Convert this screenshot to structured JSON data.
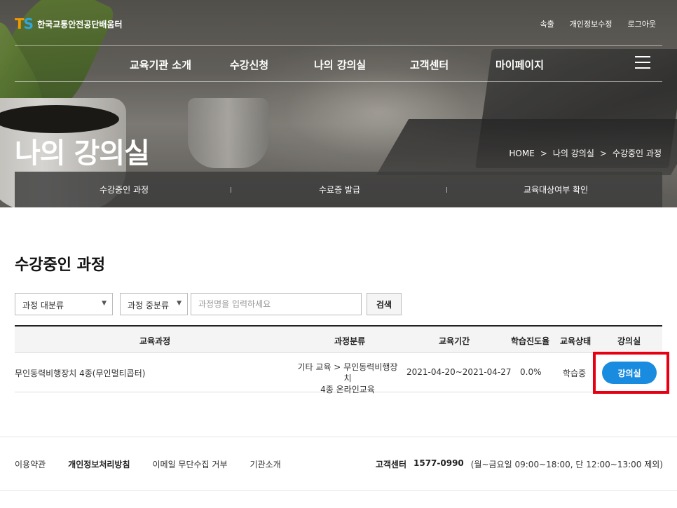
{
  "header": {
    "logo_mark_t": "T",
    "logo_mark_s": "S",
    "logo_text": "한국교통안전공단배움터",
    "util_links": [
      "속출",
      "개인정보수정",
      "로그아웃"
    ],
    "gnb": [
      "교육기관 소개",
      "수강신청",
      "나의 강의실",
      "고객센터",
      "마이페이지"
    ]
  },
  "hero": {
    "title": "나의 강의실",
    "breadcrumb": [
      "HOME",
      "나의 강의실",
      "수강중인 과정"
    ],
    "breadcrumb_sep": ">",
    "subnav": [
      "수강중인 과정",
      "수료증 발급",
      "교육대상여부 확인"
    ]
  },
  "main": {
    "section_title": "수강중인 과정",
    "filter_major": "과정 대분류",
    "filter_minor": "과정 중분류",
    "search_placeholder": "과정명을 입력하세요",
    "search_button": "검색",
    "columns": [
      "교육과정",
      "과정분류",
      "교육기간",
      "학습진도율",
      "교육상태",
      "강의실"
    ],
    "rows": [
      {
        "course": "무인동력비행장치 4종(무인멀티콥터)",
        "category_line1": "기타 교육 > 무인동력비행장치",
        "category_line2": "4종 온라인교육",
        "period": "2021-04-20~2021-04-27",
        "progress": "0.0%",
        "status": "학습중",
        "action": "강의실"
      }
    ]
  },
  "footer": {
    "links": [
      "이용약관",
      "개인정보처리방침",
      "이메일 무단수집 거부",
      "기관소개"
    ],
    "contact_label": "고객센터",
    "contact_phone": "1577-0990",
    "contact_hours": "(월~금요일 09:00~18:00, 단 12:00~13:00 제외)"
  },
  "colors": {
    "accent_blue": "#1a8ce0",
    "highlight_red": "#e60012",
    "logo_orange": "#f39800",
    "logo_blue": "#2ea7e0"
  },
  "icons": [
    "hamburger-menu-icon",
    "dropdown-arrow-icon"
  ]
}
